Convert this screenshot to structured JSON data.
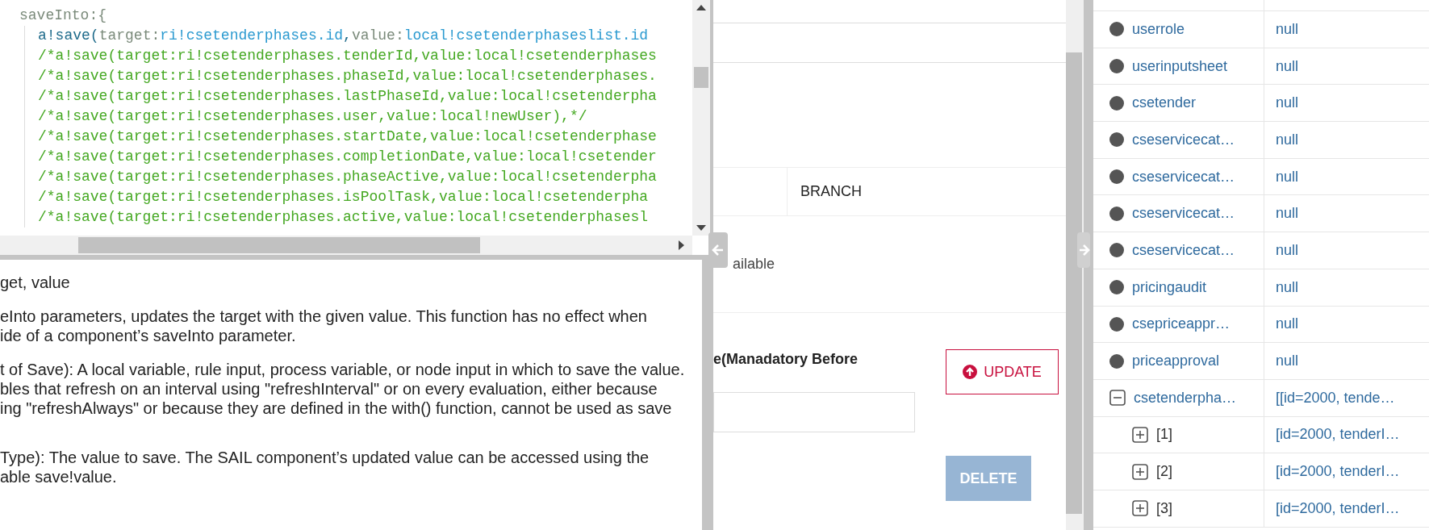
{
  "code_editor": {
    "lines": [
      {
        "tokens": [
          {
            "text": "saveInto:{",
            "kind": "plain"
          }
        ],
        "children": [
          {
            "tokens": [
              {
                "text": "a!save(",
                "kind": "function"
              },
              {
                "text": "target:",
                "kind": "plain"
              },
              {
                "text": "ri!csetenderphases.id",
                "kind": "reference"
              },
              {
                "text": ",",
                "kind": "function"
              },
              {
                "text": "value:",
                "kind": "plain"
              },
              {
                "text": "local!csetenderphaseslist.id",
                "kind": "reference"
              }
            ]
          },
          {
            "tokens": [
              {
                "text": "/*a!save(target:ri!csetenderphases.tenderId,value:local!csetenderphases",
                "kind": "comment"
              }
            ]
          },
          {
            "tokens": [
              {
                "text": "/*a!save(target:ri!csetenderphases.phaseId,value:local!csetenderphases.",
                "kind": "comment"
              }
            ]
          },
          {
            "tokens": [
              {
                "text": "/*a!save(target:ri!csetenderphases.lastPhaseId,value:local!csetenderpha",
                "kind": "comment"
              }
            ]
          },
          {
            "tokens": [
              {
                "text": "/*a!save(target:ri!csetenderphases.user,value:local!newUser),*/",
                "kind": "comment"
              }
            ]
          },
          {
            "tokens": [
              {
                "text": "/*a!save(target:ri!csetenderphases.startDate,value:local!csetenderphase",
                "kind": "comment"
              }
            ]
          },
          {
            "tokens": [
              {
                "text": "/*a!save(target:ri!csetenderphases.completionDate,value:local!csetender",
                "kind": "comment"
              }
            ]
          },
          {
            "tokens": [
              {
                "text": "/*a!save(target:ri!csetenderphases.phaseActive,value:local!csetenderpha",
                "kind": "comment"
              }
            ]
          },
          {
            "tokens": [
              {
                "text": "/*a!save(target:ri!csetenderphases.isPoolTask,value:local!csetenderpha",
                "kind": "comment"
              }
            ]
          },
          {
            "tokens": [
              {
                "text": "/*a!save(target:ri!csetenderphases.active,value:local!csetenderphasesl",
                "kind": "comment"
              }
            ]
          }
        ]
      }
    ]
  },
  "help_panel": {
    "paragraphs": [
      {
        "lines": [
          "get, value"
        ]
      },
      {
        "lines": [
          "eInto parameters, updates the target with the given value. This function has no effect when",
          "ide of a component’s saveInto parameter."
        ]
      },
      {
        "lines": [
          "t of Save): A local variable, rule input, process variable, or node input in which to save the value.",
          "bles that refresh on an interval using \"refreshInterval\" or on every evaluation, either because",
          "ing \"refreshAlways\" or because they are defined in the with() function, cannot be used as save"
        ]
      },
      {
        "lines": [
          "Type): The value to save. The SAIL component’s updated value can be accessed using the",
          "able save!value."
        ]
      }
    ]
  },
  "form": {
    "cell": "BRANCH",
    "status_text": "ailable",
    "field_label": "e(Manadatory Before",
    "update_button": {
      "label": "UPDATE",
      "disabled": false
    },
    "delete_button": {
      "label": "DELETE",
      "disabled": true
    }
  },
  "variables": [
    {
      "name": "userrole",
      "value": "null",
      "kind": "leaf"
    },
    {
      "name": "userinputsheet",
      "value": "null",
      "kind": "leaf"
    },
    {
      "name": "csetender",
      "value": "null",
      "kind": "leaf"
    },
    {
      "name": "cseservicecat…",
      "value": "null",
      "kind": "leaf"
    },
    {
      "name": "cseservicecat…",
      "value": "null",
      "kind": "leaf"
    },
    {
      "name": "cseservicecat…",
      "value": "null",
      "kind": "leaf"
    },
    {
      "name": "cseservicecat…",
      "value": "null",
      "kind": "leaf"
    },
    {
      "name": "pricingaudit",
      "value": "null",
      "kind": "leaf"
    },
    {
      "name": "csepriceappr…",
      "value": "null",
      "kind": "leaf"
    },
    {
      "name": "priceapproval",
      "value": "null",
      "kind": "leaf"
    },
    {
      "name": "csetenderpha…",
      "value": "[[id=2000, tende…",
      "kind": "group",
      "expanded": true,
      "children": [
        {
          "name": "[1]",
          "value": "[id=2000, tenderI…",
          "kind": "group",
          "expanded": false
        },
        {
          "name": "[2]",
          "value": "[id=2000, tenderI…",
          "kind": "group",
          "expanded": false
        },
        {
          "name": "[3]",
          "value": "[id=2000, tenderI…",
          "kind": "group",
          "expanded": false
        }
      ]
    }
  ]
}
